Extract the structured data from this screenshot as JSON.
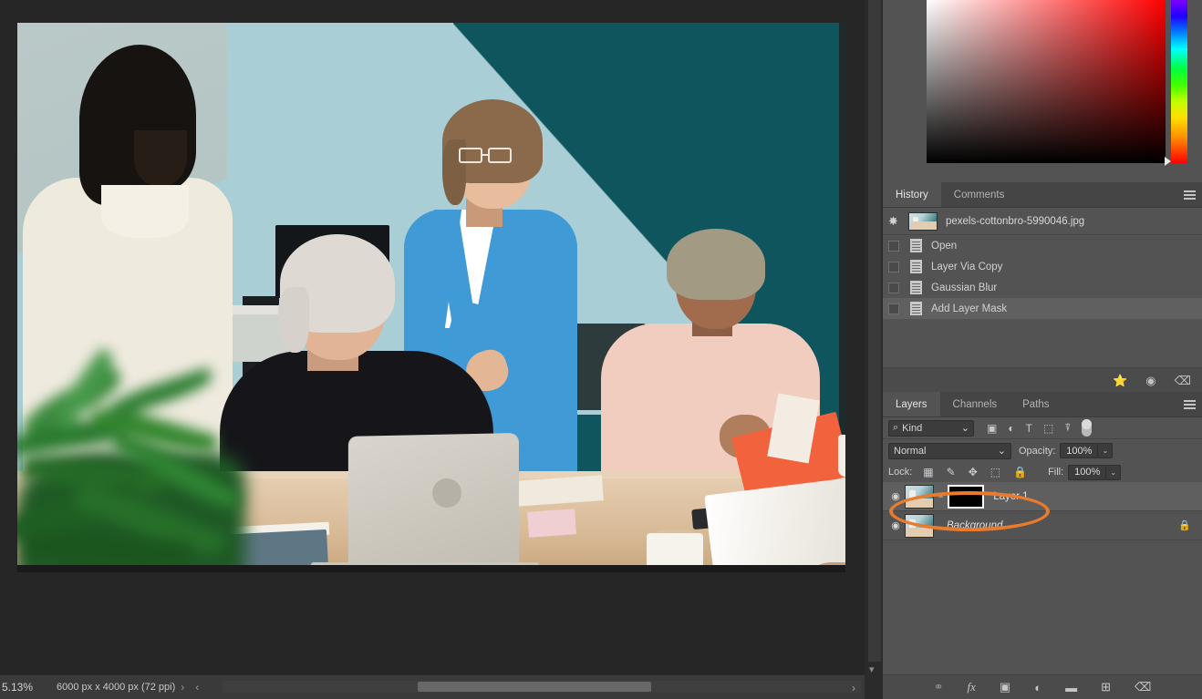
{
  "document": {
    "filename": "pexels-cottonbro-5990046.jpg",
    "zoom": "5.13%",
    "dimensions": "6000 px x 4000 px (72 ppi)",
    "nav_next": "›",
    "nav_prev": "‹",
    "status_right_chevron": "›"
  },
  "color_picker": {
    "name": "color-picker",
    "hue_marker": "▶"
  },
  "history_panel": {
    "tabs": [
      {
        "label": "History",
        "active": true
      },
      {
        "label": "Comments",
        "active": false
      }
    ],
    "snapshot": {
      "label": "pexels-cottonbro-5990046.jpg",
      "icon": "snapshot-brush-icon"
    },
    "states": [
      {
        "label": "Open",
        "current": false
      },
      {
        "label": "Layer Via Copy",
        "current": false
      },
      {
        "label": "Gaussian Blur",
        "current": false
      },
      {
        "label": "Add Layer Mask",
        "current": true
      }
    ],
    "footer_buttons": [
      {
        "name": "create-document-from-state",
        "glyph": "❐"
      },
      {
        "name": "create-new-snapshot",
        "glyph": "▣"
      },
      {
        "name": "delete-state",
        "glyph": "Ὕ1"
      }
    ]
  },
  "layers_panel": {
    "tabs": [
      {
        "label": "Layers",
        "active": true
      },
      {
        "label": "Channels",
        "active": false
      },
      {
        "label": "Paths",
        "active": false
      }
    ],
    "filter": {
      "search_icon": "⌕",
      "kind_label": "Kind",
      "chevron": "⌄",
      "filter_icons": [
        {
          "name": "filter-pixel-layers-icon",
          "glyph": "ὛB"
        },
        {
          "name": "filter-adjustment-layers-icon",
          "glyph": "◐"
        },
        {
          "name": "filter-type-layers-icon",
          "glyph": "T"
        },
        {
          "name": "filter-shape-layers-icon",
          "glyph": "⬚"
        },
        {
          "name": "filter-smart-objects-icon",
          "glyph": "὜E"
        }
      ],
      "toggle_name": "filter-enable-toggle"
    },
    "blend": {
      "mode": "Normal",
      "chevron": "⌄",
      "opacity_label": "Opacity:",
      "opacity_value": "100%",
      "stepper": "⌄"
    },
    "lock": {
      "label": "Lock:",
      "icons": [
        {
          "name": "lock-transparent-pixels-icon",
          "glyph": "▦"
        },
        {
          "name": "lock-image-pixels-icon",
          "glyph": "✎"
        },
        {
          "name": "lock-position-icon",
          "glyph": "✥"
        },
        {
          "name": "lock-artboard-nesting-icon",
          "glyph": "⬚"
        },
        {
          "name": "lock-all-icon",
          "glyph": "🔒"
        }
      ],
      "fill_label": "Fill:",
      "fill_value": "100%",
      "stepper": "⌄"
    },
    "layers": [
      {
        "name": "Layer 1",
        "visible": true,
        "selected": true,
        "italic": false,
        "has_mask": true,
        "mask_linked": true,
        "locked": false,
        "eye_glyph": "◉",
        "link_glyph": "⚭",
        "annotated": true
      },
      {
        "name": "Background",
        "visible": true,
        "selected": false,
        "italic": true,
        "has_mask": false,
        "mask_linked": false,
        "locked": true,
        "eye_glyph": "◉",
        "lock_glyph": "🔒"
      }
    ],
    "footer_buttons": [
      {
        "name": "link-layers-button",
        "glyph": "⚭",
        "dim": true
      },
      {
        "name": "layer-style-fx-button",
        "glyph": "fx"
      },
      {
        "name": "add-layer-mask-button",
        "glyph": "▣"
      },
      {
        "name": "new-adjustment-layer-button",
        "glyph": "◐"
      },
      {
        "name": "new-group-button",
        "glyph": "▰"
      },
      {
        "name": "new-layer-button",
        "glyph": "⊞"
      },
      {
        "name": "delete-layer-button",
        "glyph": "🗑"
      }
    ]
  },
  "annotation": {
    "color": "#e87b2e",
    "target": "Layer 1"
  },
  "theme": {
    "panel_bg": "#535353",
    "tabbar_bg": "#454545",
    "canvas_bg": "#262626",
    "accent_orange": "#e87b2e",
    "wall_light": "#a9ced6",
    "wall_teal": "#0f555e"
  }
}
